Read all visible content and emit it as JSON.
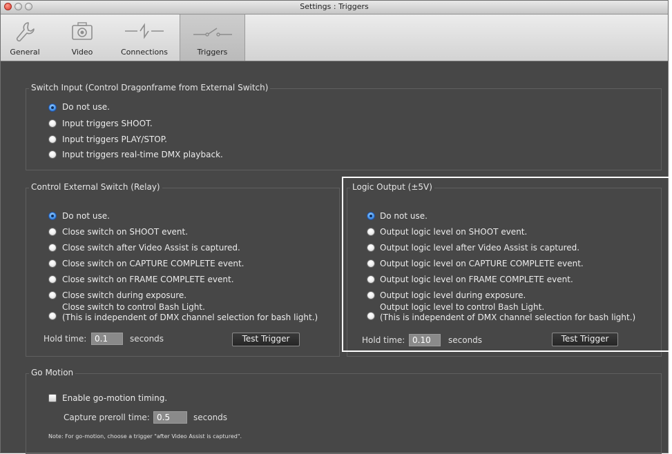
{
  "window": {
    "title": "Settings : Triggers"
  },
  "toolbar": {
    "tabs": [
      {
        "label": "General",
        "icon": "wrench-icon"
      },
      {
        "label": "Video",
        "icon": "camera-icon"
      },
      {
        "label": "Connections",
        "icon": "connection-icon"
      },
      {
        "label": "Triggers",
        "icon": "switch-icon"
      }
    ],
    "selected": "Triggers"
  },
  "switch_input": {
    "legend": "Switch Input (Control Dragonframe from External Switch)",
    "options": [
      {
        "label": "Do not use.",
        "selected": true
      },
      {
        "label": "Input triggers SHOOT.",
        "selected": false
      },
      {
        "label": "Input triggers PLAY/STOP.",
        "selected": false
      },
      {
        "label": "Input triggers real-time DMX playback.",
        "selected": false
      }
    ]
  },
  "relay": {
    "legend": "Control External Switch (Relay)",
    "options": [
      {
        "label": "Do not use.",
        "selected": true
      },
      {
        "label": "Close switch on SHOOT event.",
        "selected": false
      },
      {
        "label": "Close switch after Video Assist is captured.",
        "selected": false
      },
      {
        "label": "Close switch on CAPTURE COMPLETE event.",
        "selected": false
      },
      {
        "label": "Close switch on FRAME COMPLETE event.",
        "selected": false
      },
      {
        "label": "Close switch during exposure.",
        "selected": false
      },
      {
        "label": "Close switch to control Bash Light.",
        "label2": "(This is independent of DMX channel selection for bash light.)",
        "selected": false
      }
    ],
    "hold_label": "Hold time:",
    "hold_value": "0.1",
    "hold_unit": "seconds",
    "test_button": "Test Trigger"
  },
  "logic": {
    "legend": "Logic Output (±5V)",
    "options": [
      {
        "label": "Do not use.",
        "selected": true
      },
      {
        "label": "Output logic level on SHOOT event.",
        "selected": false
      },
      {
        "label": "Output logic level after Video Assist is captured.",
        "selected": false
      },
      {
        "label": "Output logic level on CAPTURE COMPLETE event.",
        "selected": false
      },
      {
        "label": "Output logic level on FRAME COMPLETE event.",
        "selected": false
      },
      {
        "label": "Output logic level during exposure.",
        "selected": false
      },
      {
        "label": "Output logic level to control Bash Light.",
        "label2": "(This is independent of DMX channel selection for bash light.)",
        "selected": false
      }
    ],
    "hold_label": "Hold time:",
    "hold_value": "0.10",
    "hold_unit": "seconds",
    "test_button": "Test Trigger"
  },
  "go_motion": {
    "legend": "Go Motion",
    "enable_label": "Enable go-motion timing.",
    "enabled": false,
    "preroll_label": "Capture preroll time:",
    "preroll_value": "0.5",
    "preroll_unit": "seconds",
    "note": "Note: For go-motion, choose a trigger \"after Video Assist is captured\"."
  },
  "colors": {
    "panel_bg": "#474747",
    "selected_radio": "#4f9cf0",
    "highlight_border": "#ffffff"
  }
}
